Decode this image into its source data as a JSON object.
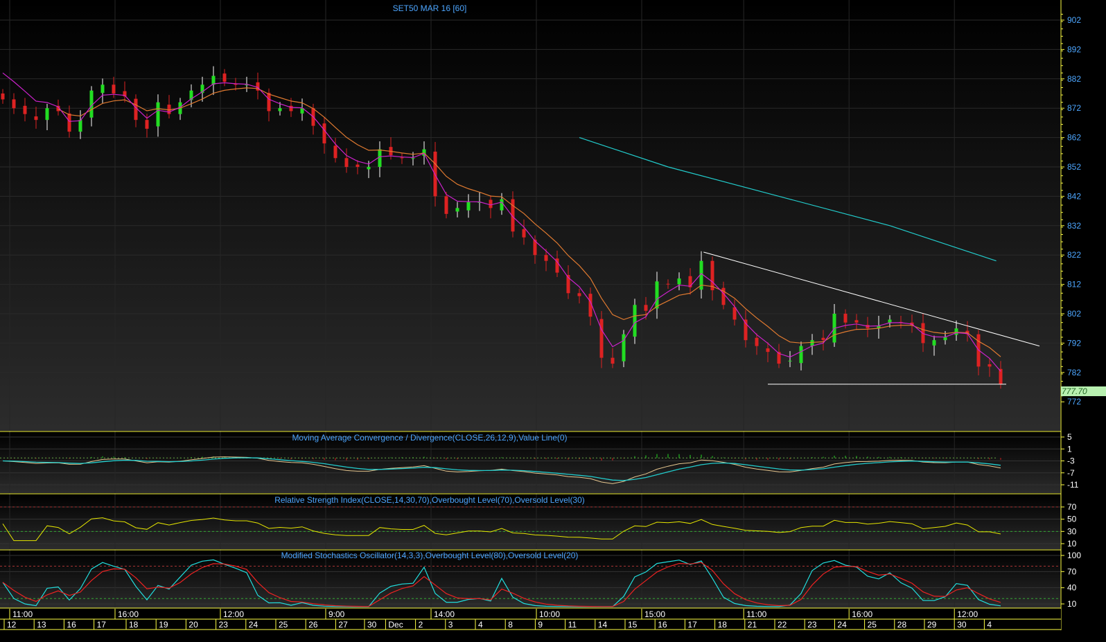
{
  "chart_data": {
    "type": "candlestick",
    "title": "SET50 MAR 16  [60]",
    "last_price": "777.70",
    "price_axis": {
      "ticks": [
        902,
        892,
        882,
        872,
        862,
        852,
        842,
        832,
        822,
        812,
        802,
        792,
        782,
        772
      ],
      "range": [
        767,
        908
      ]
    },
    "closes": [
      875,
      872,
      870,
      868,
      872,
      871,
      864,
      868,
      878,
      880,
      877,
      876,
      868,
      865,
      874,
      870,
      874,
      878,
      880,
      883,
      881,
      880,
      880,
      878,
      871,
      872,
      871,
      872,
      866,
      860,
      855,
      852,
      852,
      852,
      858,
      856,
      855,
      855,
      858,
      842,
      836,
      838,
      840,
      840,
      838,
      841,
      830,
      828,
      822,
      820,
      816,
      809,
      808,
      801,
      787,
      785,
      795,
      805,
      803,
      813,
      812,
      814,
      811,
      820,
      810,
      805,
      800,
      793,
      791,
      789,
      785,
      786,
      791,
      793,
      793,
      802,
      799,
      799,
      797,
      798,
      800,
      799,
      798,
      792,
      793,
      794,
      797,
      795,
      784,
      784,
      778
    ],
    "long_ma": {
      "points": [
        [
          52,
          862
        ],
        [
          60,
          852
        ],
        [
          70,
          842
        ],
        [
          80,
          832
        ],
        [
          89.6,
          820
        ]
      ]
    },
    "trendlines": [
      {
        "from": [
          63.2,
          823
        ],
        "to": [
          93.5,
          791
        ]
      },
      {
        "from": [
          69,
          778
        ],
        "to": [
          90.5,
          778
        ]
      }
    ],
    "x_time_labels": [
      {
        "i": 1,
        "label": "11:00"
      },
      {
        "i": 10.5,
        "label": "16:00"
      },
      {
        "i": 20,
        "label": "12:00"
      },
      {
        "i": 29.5,
        "label": "9:00"
      },
      {
        "i": 39,
        "label": "14:00"
      },
      {
        "i": 48.5,
        "label": "10:00"
      },
      {
        "i": 58,
        "label": "15:00"
      },
      {
        "i": 67.2,
        "label": "11:00"
      },
      {
        "i": 76.7,
        "label": "16:00"
      },
      {
        "i": 86.2,
        "label": "12:00"
      }
    ],
    "x_date_labels": [
      {
        "i": 0.5,
        "label": "12"
      },
      {
        "i": 3.2,
        "label": "13"
      },
      {
        "i": 5.9,
        "label": "16"
      },
      {
        "i": 8.6,
        "label": "17"
      },
      {
        "i": 11.5,
        "label": "18"
      },
      {
        "i": 14.2,
        "label": "19"
      },
      {
        "i": 16.9,
        "label": "20"
      },
      {
        "i": 19.6,
        "label": "23"
      },
      {
        "i": 22.3,
        "label": "24"
      },
      {
        "i": 25,
        "label": "25"
      },
      {
        "i": 27.7,
        "label": "26"
      },
      {
        "i": 30.4,
        "label": "27"
      },
      {
        "i": 33,
        "label": "30"
      },
      {
        "i": 34.9,
        "label": "Dec"
      },
      {
        "i": 37.6,
        "label": "2"
      },
      {
        "i": 40.3,
        "label": "3"
      },
      {
        "i": 43,
        "label": "4"
      },
      {
        "i": 45.7,
        "label": "8"
      },
      {
        "i": 48.4,
        "label": "9"
      },
      {
        "i": 51.1,
        "label": "11"
      },
      {
        "i": 53.8,
        "label": "14"
      },
      {
        "i": 56.5,
        "label": "15"
      },
      {
        "i": 59.2,
        "label": "16"
      },
      {
        "i": 61.9,
        "label": "17"
      },
      {
        "i": 64.6,
        "label": "18"
      },
      {
        "i": 67.3,
        "label": "21"
      },
      {
        "i": 70,
        "label": "22"
      },
      {
        "i": 72.7,
        "label": "23"
      },
      {
        "i": 75.4,
        "label": "24"
      },
      {
        "i": 78.1,
        "label": "25"
      },
      {
        "i": 80.8,
        "label": "28"
      },
      {
        "i": 83.5,
        "label": "29"
      },
      {
        "i": 86.2,
        "label": "30"
      },
      {
        "i": 88.9,
        "label": "4"
      }
    ],
    "indicators": [
      {
        "key": "macd",
        "title": "Moving Average Convergence / Divergence(CLOSE,26,12,9),Value Line(0)",
        "ticks": [
          5,
          1,
          -3,
          -7,
          -11
        ],
        "range": [
          5,
          -11
        ]
      },
      {
        "key": "rsi",
        "title": "Relative Strength Index(CLOSE,14,30,70),Overbought Level(70),Oversold Level(30)",
        "ticks": [
          70,
          50,
          30,
          10
        ],
        "range": [
          70,
          10
        ]
      },
      {
        "key": "stoch",
        "title": "Modified Stochastics Oscillator(14,3,3),Overbought Level(80),Oversold Level(20)",
        "ticks": [
          100,
          70,
          40,
          10
        ],
        "range": [
          100,
          10
        ]
      }
    ],
    "colors": {
      "up": "#22dd22",
      "down": "#dd2222",
      "ma_fast": "#cc22cc",
      "ma_slow": "#e07a30",
      "ma_long": "#22cccc",
      "axis": "#ffff44",
      "price_label": "#4da6ff",
      "title": "#4da6ff",
      "last_bg": "#b8f0b0"
    }
  }
}
